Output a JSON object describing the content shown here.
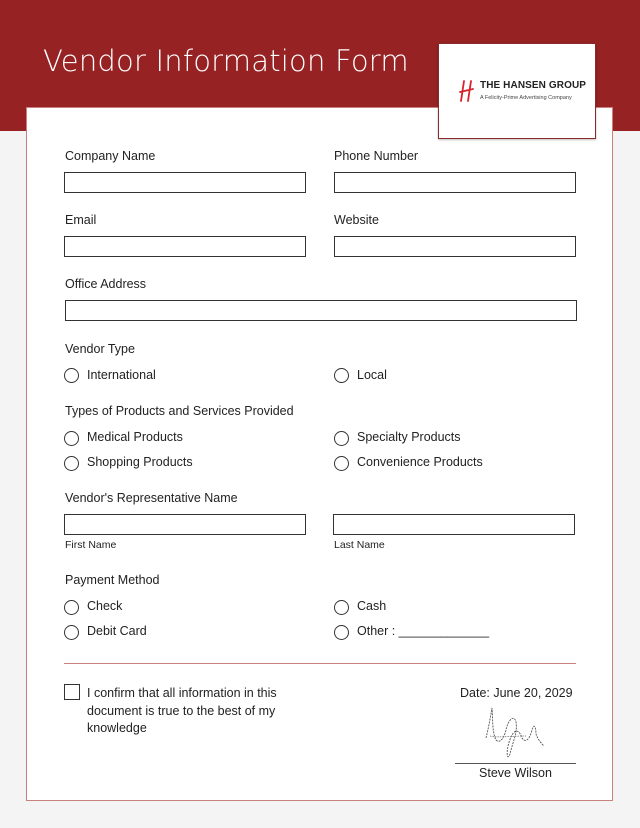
{
  "header": {
    "title": "Vendor Information Form",
    "brand_color": "#962224"
  },
  "logo": {
    "mark_icon": "hansen-h-logo-icon",
    "name": "THE HANSEN GROUP",
    "tagline": "A Felicity-Prime Advertising Company"
  },
  "fields": {
    "company_name": {
      "label": "Company Name",
      "value": ""
    },
    "phone_number": {
      "label": "Phone Number",
      "value": ""
    },
    "email": {
      "label": "Email",
      "value": ""
    },
    "website": {
      "label": "Website",
      "value": ""
    },
    "office_address": {
      "label": "Office Address",
      "value": ""
    }
  },
  "vendor_type": {
    "label": "Vendor Type",
    "options": [
      "International",
      "Local"
    ],
    "selected": null
  },
  "products": {
    "label": "Types of Products and Services Provided",
    "options": [
      "Medical Products",
      "Specialty Products",
      "Shopping Products",
      "Convenience Products"
    ],
    "selected": null
  },
  "representative": {
    "label": "Vendor's Representative Name",
    "first_name_label": "First Name",
    "last_name_label": "Last Name",
    "first_name": "",
    "last_name": ""
  },
  "payment": {
    "label": "Payment Method",
    "options": [
      "Check",
      "Cash",
      "Debit Card",
      "Other : _____________"
    ],
    "selected": null
  },
  "confirmation": {
    "text": "I confirm that all information in this document is true to the best of my knowledge",
    "checked": false
  },
  "signoff": {
    "date": "Date: June 20, 2029",
    "signer": "Steve Wilson"
  }
}
